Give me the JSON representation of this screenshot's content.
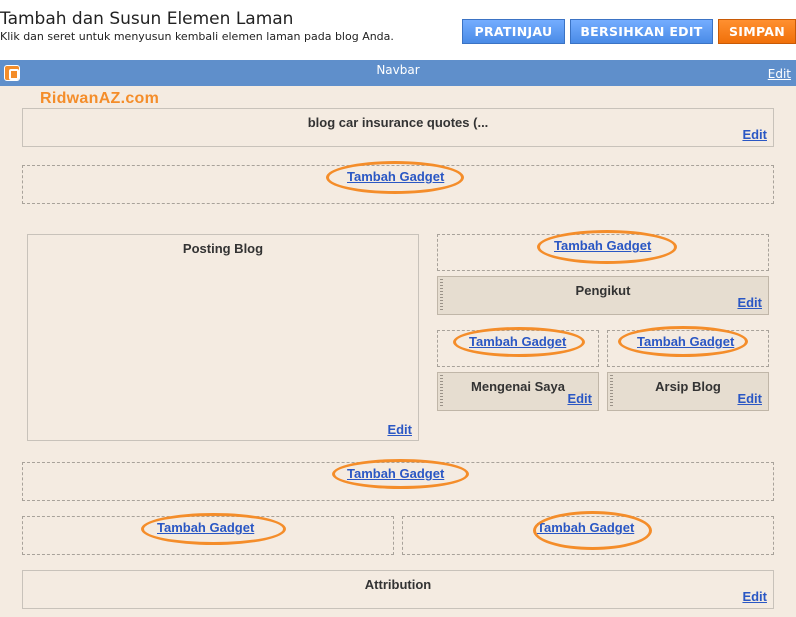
{
  "header": {
    "title": "Tambah dan Susun Elemen Laman",
    "subtitle": "Klik dan seret untuk menyusun kembali elemen laman pada blog Anda.",
    "buttons": {
      "preview": "PRATINJAU",
      "clear_edits": "BERSIHKAN EDIT",
      "save": "SIMPAN"
    }
  },
  "navbar": {
    "title": "Navbar",
    "edit": "Edit",
    "icon": "blogger-icon"
  },
  "watermark": "RidwanAZ.com",
  "layout": {
    "header_gadget": {
      "title": "blog car insurance quotes (...",
      "edit": "Edit"
    },
    "add_gadget_label": "Tambah Gadget",
    "main": {
      "title": "Posting Blog",
      "edit": "Edit"
    },
    "sidebar": {
      "followers": {
        "title": "Pengikut",
        "edit": "Edit"
      },
      "about": {
        "title": "Mengenai Saya",
        "edit": "Edit"
      },
      "archive": {
        "title": "Arsip Blog",
        "edit": "Edit"
      }
    },
    "footer": {
      "title": "Attribution",
      "edit": "Edit"
    }
  },
  "colors": {
    "accent_orange": "#f48d2a",
    "button_blue": "#5b9bf5",
    "navbar_blue": "#5f8fcb",
    "canvas": "#f4ebe1",
    "link": "#2a57c4"
  }
}
